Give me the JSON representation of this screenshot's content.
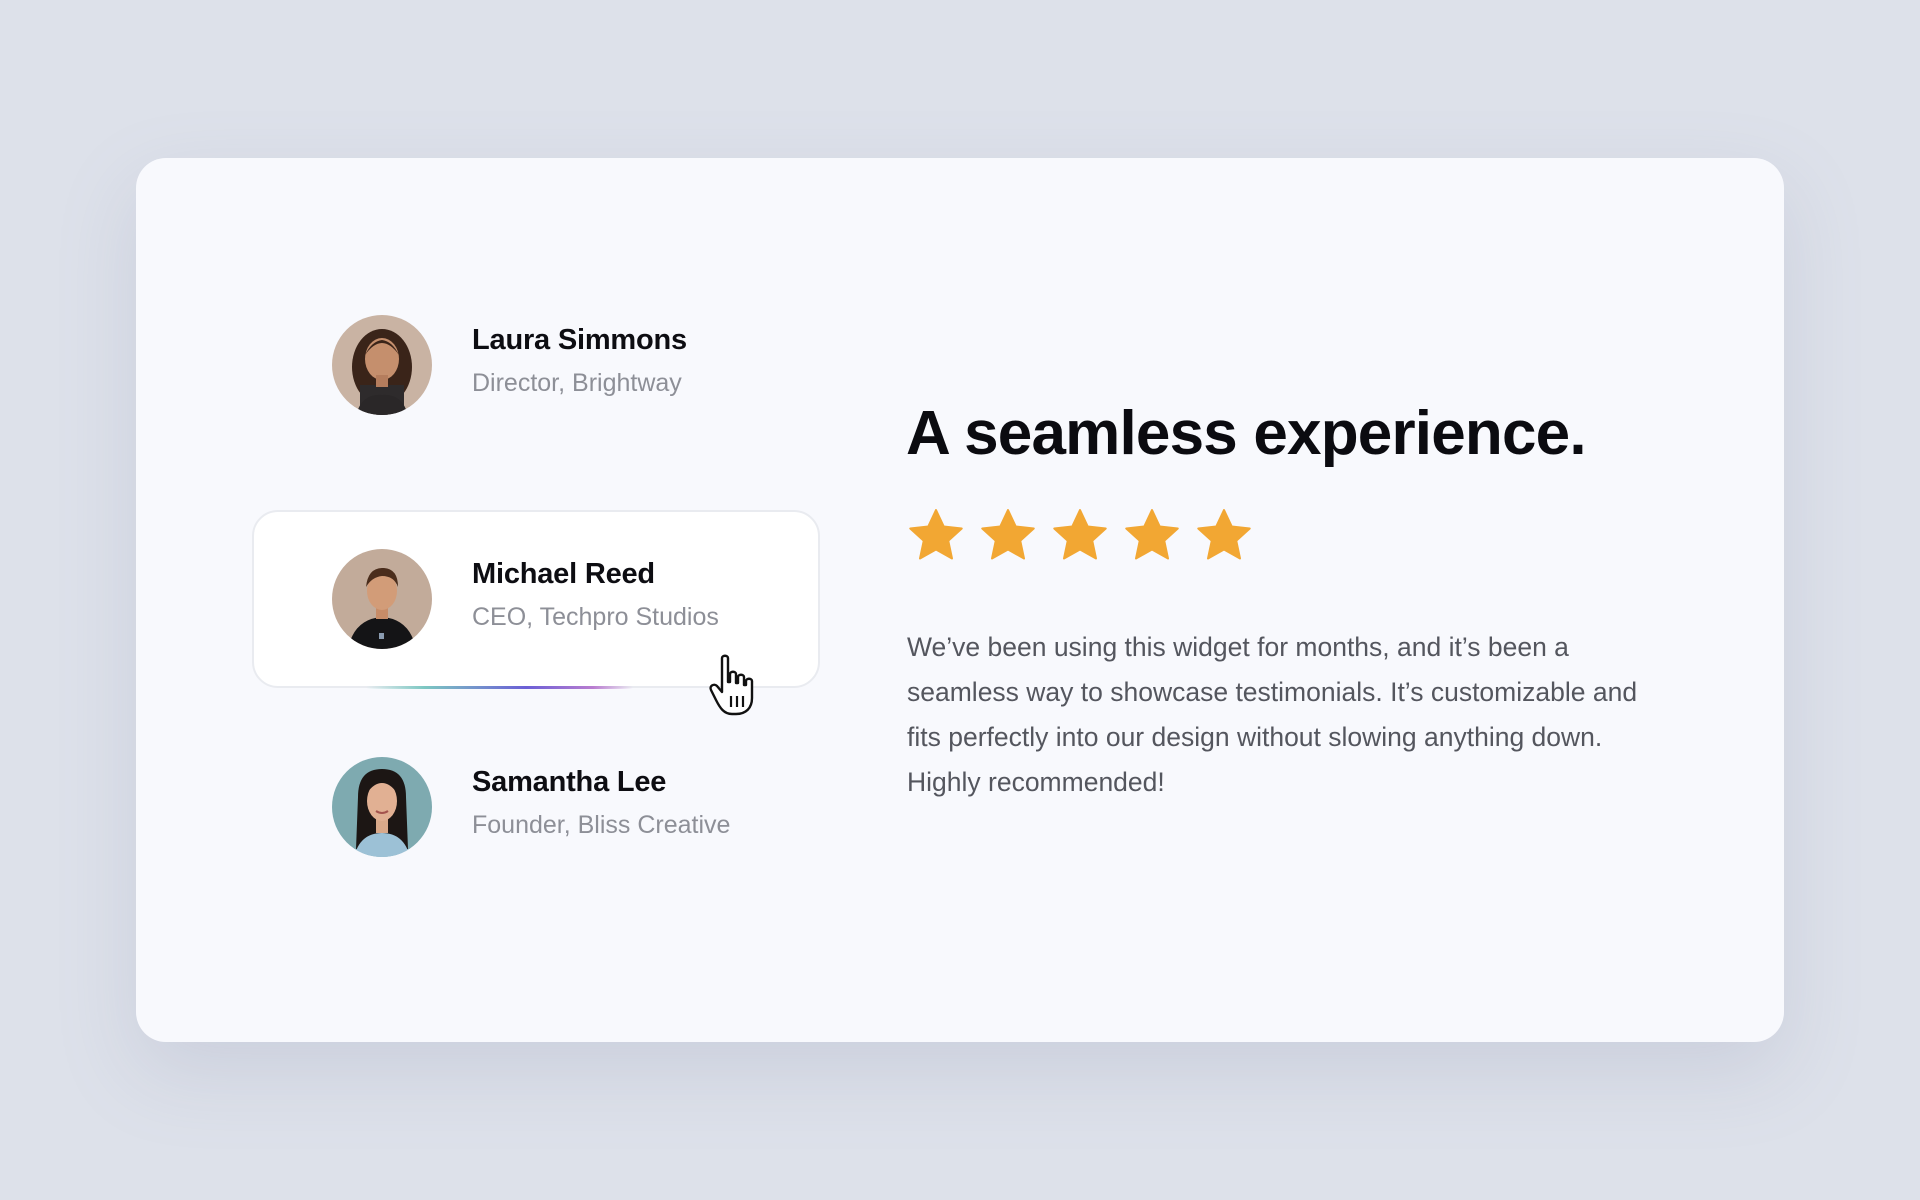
{
  "testimonials": [
    {
      "name": "Laura Simmons",
      "role": "Director, Brightway",
      "avatar": "woman-curly-hair-avatar",
      "active": false
    },
    {
      "name": "Michael Reed",
      "role": "CEO, Techpro Studios",
      "avatar": "man-hoodie-avatar",
      "active": true
    },
    {
      "name": "Samantha Lee",
      "role": "Founder, Bliss Creative",
      "avatar": "woman-straight-hair-avatar",
      "active": false
    }
  ],
  "active_progress": 0.65,
  "review": {
    "headline": "A seamless experience.",
    "rating": 5,
    "rating_max": 5,
    "quote": "We’ve been using this widget for months, and it’s been a seamless way to showcase testimonials. It’s customizable and fits perfectly into our design without slowing anything down. Highly recommended!"
  },
  "colors": {
    "page_background": "#dde1ea",
    "card_background": "#f8f9fd",
    "star": "#f2a733",
    "name": "#0d0d12",
    "role": "#8d8f97",
    "quote": "#54565e",
    "progress_gradient": [
      "#7cc7c2",
      "#6b5fd6",
      "#b97dd0"
    ]
  },
  "icons": {
    "star": "star-icon",
    "cursor": "hand-pointer-icon"
  }
}
